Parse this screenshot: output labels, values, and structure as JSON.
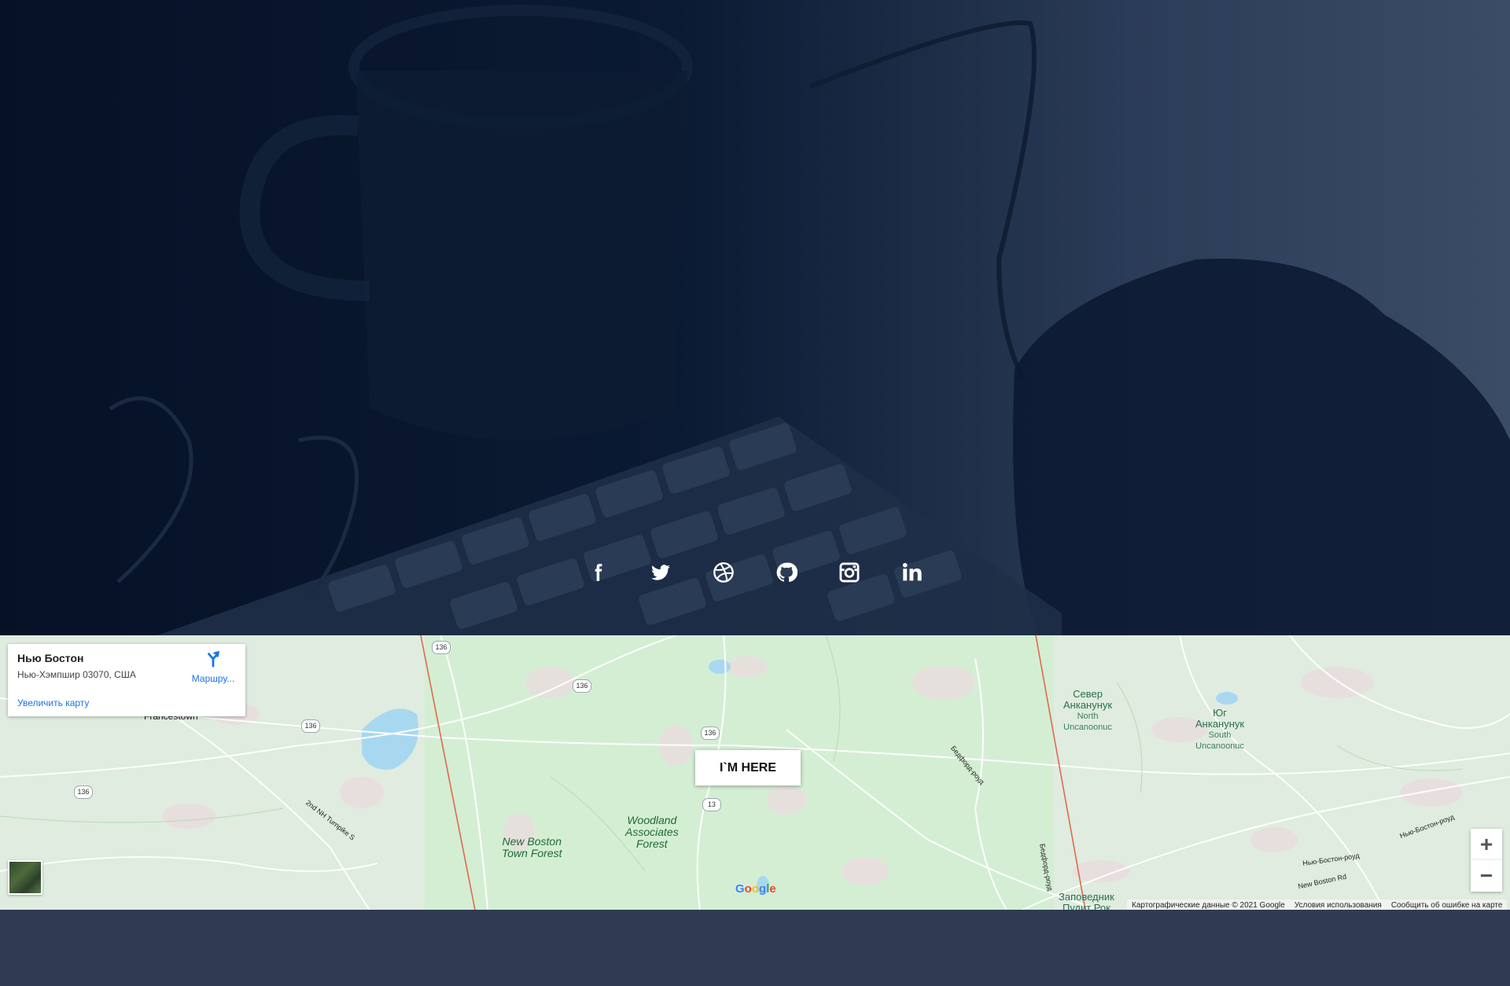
{
  "social": {
    "icons": [
      "facebook-icon",
      "twitter-icon",
      "dribbble-icon",
      "github-icon",
      "instagram-icon",
      "linkedin-icon"
    ]
  },
  "map": {
    "info": {
      "title": "Нью Бостон",
      "address": "Нью-Хэмпшир 03070, США",
      "route_label": "Маршру...",
      "enlarge": "Увеличить карту"
    },
    "marker_label": "I`M HERE",
    "places": {
      "francestown": "Francestown",
      "woodland": [
        "Woodland",
        "Associates",
        "Forest"
      ],
      "new_boston_forest": [
        "New Boston",
        "Town Forest"
      ],
      "north_uncanoonuc": [
        "Север",
        "Анканунук"
      ],
      "north_uncanoonuc_small": [
        "North",
        "Uncanoonuc"
      ],
      "south_uncanoonuc": [
        "Юг",
        "Анканунук"
      ],
      "south_uncanoonuc_small": [
        "South",
        "Uncanoonuc"
      ],
      "reserve": [
        "Заповедник",
        "Пудит Рок"
      ],
      "road_2nd": "2nd NH Turnpike S",
      "road_bedford": "Бедфорд-роуд",
      "road_nb": "New Boston Rd",
      "road_nb_ru": "Нью-Бостон-роуд",
      "road_nb_ru2": "Нью-Бостон-роуд",
      "road_bedford_v": "Бедфорд-роуд"
    },
    "shields": [
      "136",
      "136",
      "136",
      "136",
      "136",
      "13"
    ],
    "zoom_in": "+",
    "zoom_out": "−",
    "google": [
      "G",
      "o",
      "o",
      "g",
      "l",
      "e"
    ],
    "attribution": {
      "data": "Картографические данные © 2021 Google",
      "terms": "Условия использования",
      "report": "Сообщить об ошибке на карте"
    }
  },
  "colors": {
    "hero_dark": "#061126",
    "hero_light": "#3a4c66",
    "map_green": "#cfeccf",
    "footer": "#2e3b53",
    "link_blue": "#1a73e8"
  }
}
